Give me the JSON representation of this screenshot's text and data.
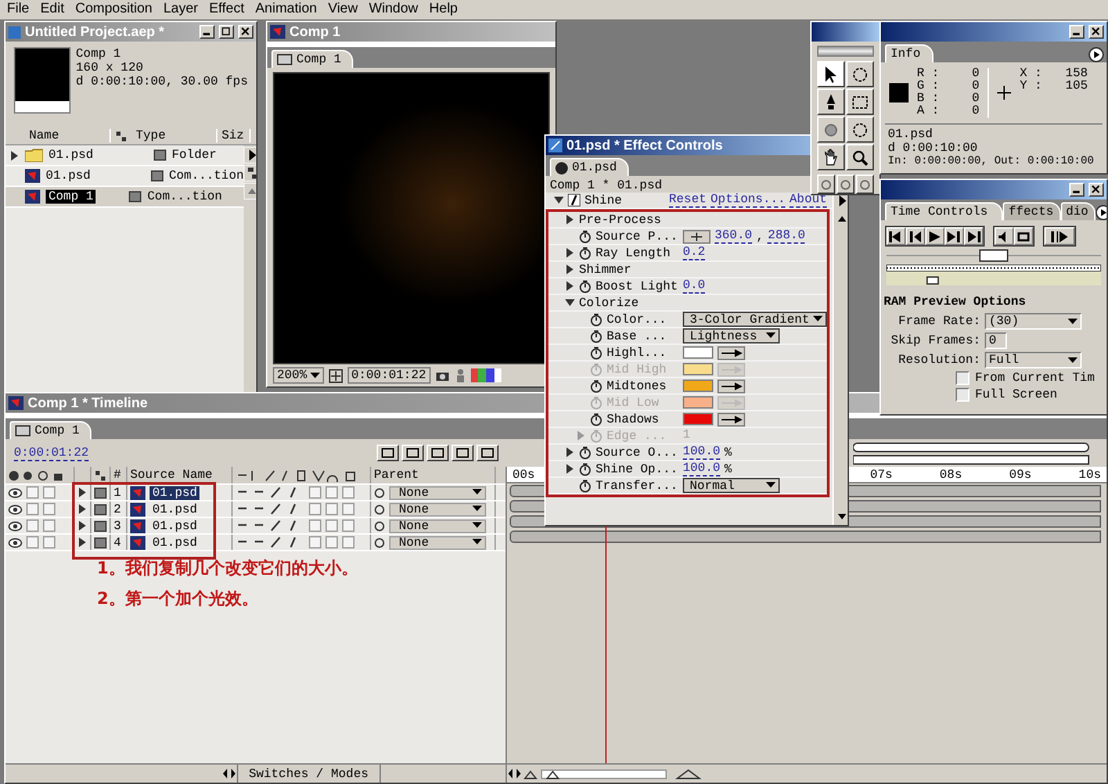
{
  "menu": [
    "File",
    "Edit",
    "Composition",
    "Layer",
    "Effect",
    "Animation",
    "View",
    "Window",
    "Help"
  ],
  "project": {
    "title": "Untitled Project.aep *",
    "comp_name": "Comp 1",
    "size": "160 x 120",
    "duration": "d 0:00:10:00, 30.00 fps",
    "columns": [
      "Name",
      "Type",
      "Siz"
    ],
    "items": [
      {
        "kind": "folder",
        "name": "01.psd",
        "type": "Folder",
        "selected": false
      },
      {
        "kind": "comp",
        "name": "01.psd",
        "type": "Com...tion",
        "selected": false
      },
      {
        "kind": "comp",
        "name": "Comp 1",
        "type": "Com...tion",
        "selected": true
      }
    ]
  },
  "comp": {
    "title": "Comp 1",
    "tab": "Comp 1",
    "zoom": "200%",
    "timecode": "0:00:01:22"
  },
  "effect_controls": {
    "title": "01.psd * Effect Controls",
    "tab": "01.psd",
    "path": "Comp 1 * 01.psd",
    "effect": {
      "name": "Shine",
      "expanded": true,
      "links": [
        "Reset",
        "Options...",
        "About"
      ]
    },
    "rows": [
      {
        "kind": "group",
        "label": "Pre-Process",
        "expanded": false
      },
      {
        "kind": "point",
        "label": "Source P...",
        "values": [
          "360.0",
          "288.0"
        ],
        "separator": ","
      },
      {
        "kind": "value",
        "label": "Ray Length",
        "value": "0.2",
        "expandable": true,
        "disabled": false
      },
      {
        "kind": "group",
        "label": "Shimmer",
        "expanded": false
      },
      {
        "kind": "value",
        "label": "Boost Light",
        "value": "0.0",
        "expandable": true,
        "disabled": false
      },
      {
        "kind": "group",
        "label": "Colorize",
        "expanded": true,
        "children": [
          {
            "kind": "dropdown",
            "label": "Color...",
            "value": "3-Color Gradient"
          },
          {
            "kind": "dropdown",
            "label": "Base ...",
            "value": "Lightness"
          },
          {
            "kind": "color",
            "label": "Highl...",
            "color": "#ffffff",
            "disabled": false
          },
          {
            "kind": "color",
            "label": "Mid High",
            "color": "#f8dc8c",
            "disabled": true
          },
          {
            "kind": "color",
            "label": "Midtones",
            "color": "#f0a818",
            "disabled": false
          },
          {
            "kind": "color",
            "label": "Mid Low",
            "color": "#f8b088",
            "disabled": true
          },
          {
            "kind": "color",
            "label": "Shadows",
            "color": "#e80808",
            "disabled": false
          },
          {
            "kind": "value",
            "label": "Edge ...",
            "value": "1",
            "expandable": true,
            "disabled": true
          }
        ]
      },
      {
        "kind": "value",
        "label": "Source O...",
        "value": "100.0",
        "unit": "%",
        "expandable": true,
        "disabled": false
      },
      {
        "kind": "value",
        "label": "Shine Op...",
        "value": "100.0",
        "unit": "%",
        "expandable": true,
        "disabled": false
      },
      {
        "kind": "dropdown",
        "label": "Transfer...",
        "value": "Normal"
      }
    ]
  },
  "info": {
    "title": "Info",
    "channels": [
      {
        "label": "R :",
        "value": "0"
      },
      {
        "label": "G :",
        "value": "0"
      },
      {
        "label": "B :",
        "value": "0"
      },
      {
        "label": "A :",
        "value": "0"
      }
    ],
    "coords": [
      {
        "label": "X :",
        "value": "158"
      },
      {
        "label": "Y :",
        "value": "105"
      }
    ],
    "file": "01.psd",
    "duration": "d 0:00:10:00",
    "in_out": "In: 0:00:00:00, Out: 0:00:10:00"
  },
  "time_controls": {
    "tabs": [
      {
        "label": "Time Controls",
        "selected": true
      },
      {
        "label": "ffects",
        "selected": false
      },
      {
        "label": "dio",
        "selected": false
      }
    ],
    "jog": {
      "level": 0.5
    },
    "time_ruler": {
      "level": 0.2
    },
    "ram_title": "RAM Preview Options",
    "frame_rate": {
      "label": "Frame Rate:",
      "value": "(30)"
    },
    "skip_frames": {
      "label": "Skip Frames:",
      "value": "0"
    },
    "resolution": {
      "label": "Resolution:",
      "value": "Full"
    },
    "options": [
      {
        "label": "From Current Tim",
        "checked": false
      },
      {
        "label": "Full Screen",
        "checked": false
      }
    ]
  },
  "timeline": {
    "title": "Comp 1 * Timeline",
    "tab": "Comp 1",
    "timecode": "0:00:01:22",
    "columns": [
      "#",
      "Source Name",
      "Parent"
    ],
    "ruler": [
      "00s",
      "07s",
      "08s",
      "09s",
      "10s"
    ],
    "layers": [
      {
        "number": "1",
        "name": "01.psd",
        "parent": "None",
        "selected": true
      },
      {
        "number": "2",
        "name": "01.psd",
        "parent": "None",
        "selected": false
      },
      {
        "number": "3",
        "name": "01.psd",
        "parent": "None",
        "selected": false
      },
      {
        "number": "4",
        "name": "01.psd",
        "parent": "None",
        "selected": false
      }
    ],
    "notes": [
      "1。我们复制几个改变它们的大小。",
      "2。第一个加个光效。"
    ],
    "footer": "Switches / Modes",
    "zoom": {
      "level": 0.05
    }
  }
}
